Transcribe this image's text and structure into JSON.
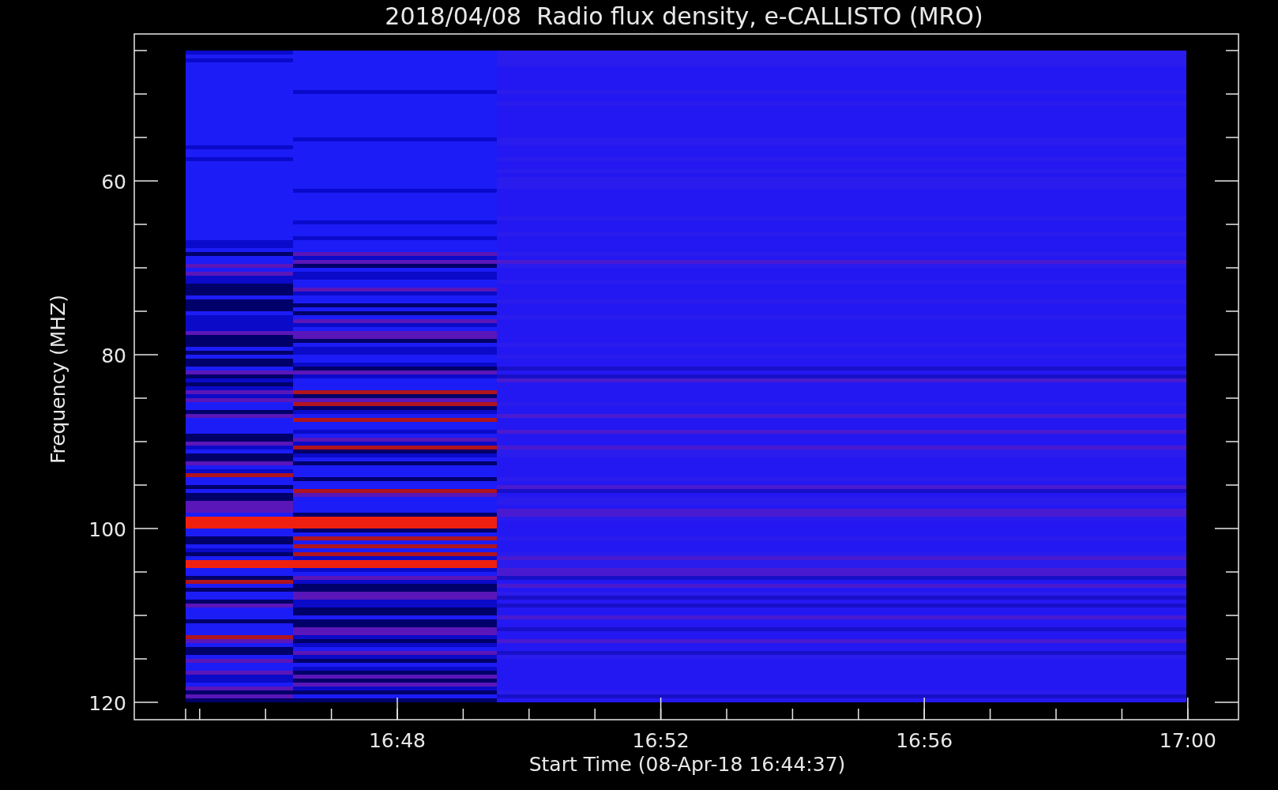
{
  "title": "2018/04/08  Radio flux density, e-CALLISTO (MRO)",
  "ylabel": "Frequency (MHZ)",
  "xlabel": "Start Time (08-Apr-18 16:44:37)",
  "yticks": [
    "60",
    "80",
    "100",
    "120"
  ],
  "xticks": [
    "16:48",
    "16:52",
    "16:56",
    "17:00"
  ]
}
